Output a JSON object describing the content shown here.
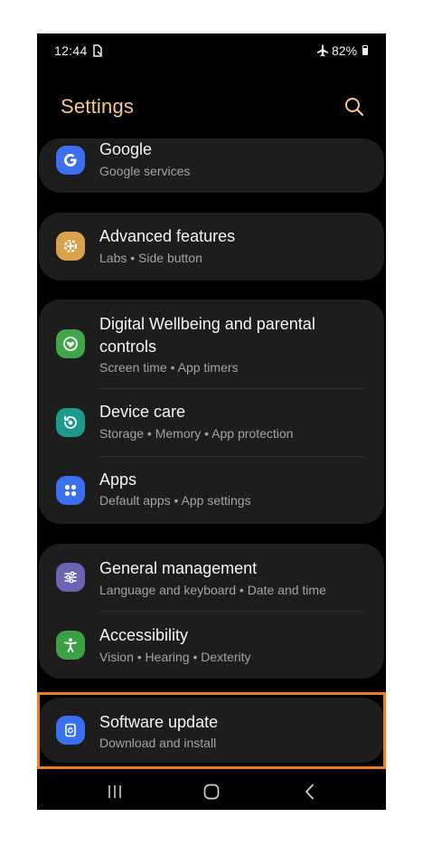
{
  "status_bar": {
    "time": "12:44",
    "battery": "82%"
  },
  "header": {
    "title": "Settings"
  },
  "items": {
    "google": {
      "label": "Google",
      "sub": "Google services",
      "icon": "google-icon",
      "color": "#3a6ff0"
    },
    "advanced": {
      "label": "Advanced features",
      "sub": "Labs  •  Side button",
      "icon": "gear-plus-icon",
      "color": "#d9a24a"
    },
    "wellbeing": {
      "label": "Digital Wellbeing and parental controls",
      "sub": "Screen time  •  App timers",
      "icon": "wellbeing-heart-icon",
      "color": "#3fa74a"
    },
    "device_care": {
      "label": "Device care",
      "sub": "Storage  •  Memory  •  App protection",
      "icon": "device-care-icon",
      "color": "#1c9b8d"
    },
    "apps": {
      "label": "Apps",
      "sub": "Default apps  •  App settings",
      "icon": "apps-grid-icon",
      "color": "#3a6ff0"
    },
    "general": {
      "label": "General management",
      "sub": "Language and keyboard  •  Date and time",
      "icon": "sliders-icon",
      "color": "#6a64b5"
    },
    "accessibility": {
      "label": "Accessibility",
      "sub": "Vision  •  Hearing  •  Dexterity",
      "icon": "accessibility-person-icon",
      "color": "#3aa046"
    },
    "software_update": {
      "label": "Software update",
      "sub": "Download and install",
      "icon": "software-update-icon",
      "color": "#3a6ff0"
    }
  },
  "highlight_color": "#ef7d21"
}
